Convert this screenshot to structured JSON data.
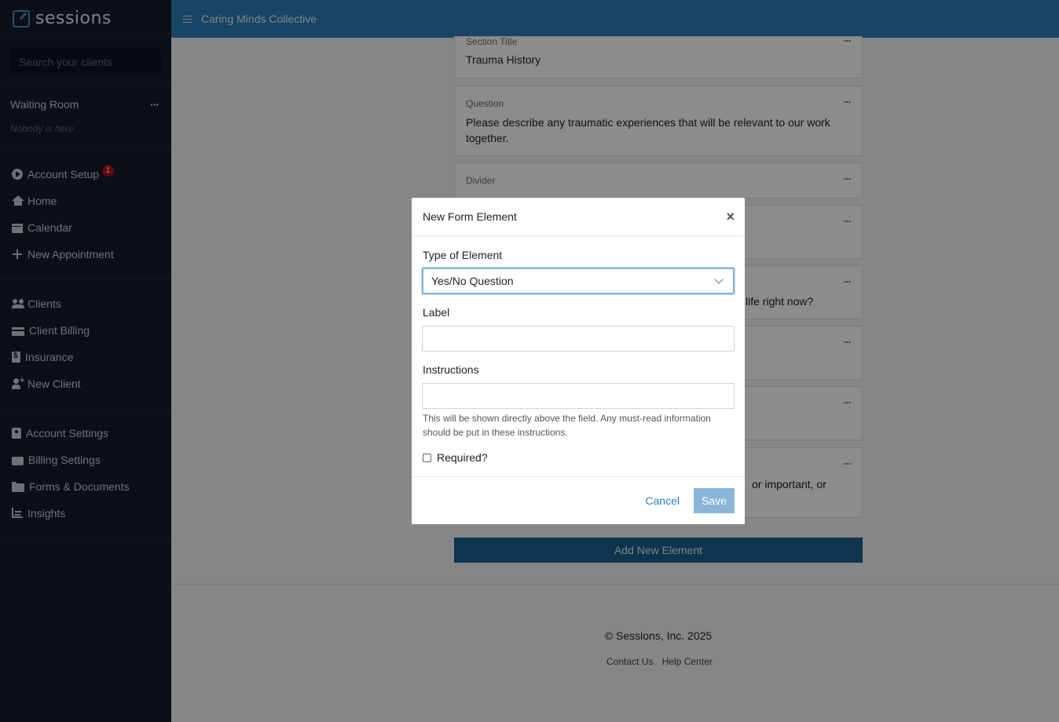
{
  "brand": {
    "name": "sessions"
  },
  "sidebar": {
    "search_placeholder": "Search your clients",
    "waiting_room": {
      "title": "Waiting Room",
      "menu": "···",
      "empty_text": "Nobody is here"
    },
    "group1": [
      {
        "label": "Account Setup",
        "icon": "play-circle-icon",
        "badge": "1"
      },
      {
        "label": "Home",
        "icon": "home-icon"
      },
      {
        "label": "Calendar",
        "icon": "calendar-icon"
      },
      {
        "label": "New Appointment",
        "icon": "plus-icon"
      }
    ],
    "group2": [
      {
        "label": "Clients",
        "icon": "users-icon"
      },
      {
        "label": "Client Billing",
        "icon": "credit-card-icon"
      },
      {
        "label": "Insurance",
        "icon": "invoice-icon"
      },
      {
        "label": "New Client",
        "icon": "user-plus-icon"
      }
    ],
    "group3": [
      {
        "label": "Account Settings",
        "icon": "contact-card-icon"
      },
      {
        "label": "Billing Settings",
        "icon": "wallet-icon"
      },
      {
        "label": "Forms & Documents",
        "icon": "folder-open-icon"
      },
      {
        "label": "Insights",
        "icon": "chart-icon"
      }
    ]
  },
  "topbar": {
    "practice_name": "Caring Minds Collective"
  },
  "form_cards": [
    {
      "label": "Section Title",
      "text": "Trauma History"
    },
    {
      "label": "Question",
      "text": "Please describe any traumatic experiences that will be relevant to our work together."
    },
    {
      "label": "Divider",
      "text": ""
    },
    {
      "label": "",
      "text": ""
    },
    {
      "label": "",
      "text": "life right now?"
    },
    {
      "label": "",
      "text": ""
    },
    {
      "label": "",
      "text": ""
    },
    {
      "label": "",
      "text": "or important, or"
    }
  ],
  "card_menu": "···",
  "add_element_label": "Add New Element",
  "footer": {
    "copyright": "© Sessions, Inc. 2025",
    "links": [
      "Contact Us",
      "Help Center"
    ]
  },
  "modal": {
    "title": "New Form Element",
    "close": "×",
    "type_label": "Type of Element",
    "type_value": "Yes/No Question",
    "label_label": "Label",
    "label_value": "",
    "instructions_label": "Instructions",
    "instructions_value": "",
    "instructions_help": "This will be shown directly above the field. Any must-read information should be put in these instructions.",
    "required_label": "Required?",
    "required_checked": false,
    "cancel_label": "Cancel",
    "save_label": "Save"
  },
  "colors": {
    "sidebar_bg": "#141c2a",
    "topbar_bg": "#2d7fb8",
    "add_button_bg": "#1a5f8f",
    "badge": "#b3131b",
    "save_button": "#89b5d8"
  }
}
